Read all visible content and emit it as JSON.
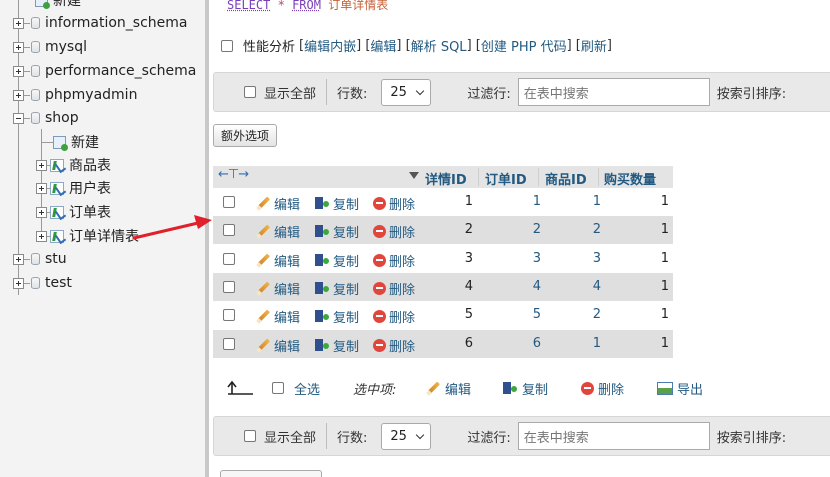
{
  "nav": {
    "items": [
      {
        "label": "新建"
      },
      {
        "label": "information_schema"
      },
      {
        "label": "mysql"
      },
      {
        "label": "performance_schema"
      },
      {
        "label": "phpmyadmin"
      },
      {
        "label": "shop"
      },
      {
        "label": "新建"
      },
      {
        "label": "商品表"
      },
      {
        "label": "用户表"
      },
      {
        "label": "订单表"
      },
      {
        "label": "订单详情表"
      },
      {
        "label": "stu"
      },
      {
        "label": "test"
      }
    ]
  },
  "query": {
    "keyword1": "SELECT",
    "operator": "*",
    "keyword2": "FROM",
    "table": "订单详情表"
  },
  "profiling": {
    "label": "性能分析",
    "links": [
      "编辑内嵌",
      "编辑",
      "解析 SQL",
      "创建 PHP 代码",
      "刷新"
    ]
  },
  "navbar": {
    "show_all": "显示全部",
    "rows_label": "行数:",
    "rows_value": "25",
    "filter_label": "过滤行:",
    "filter_placeholder": "在表中搜索",
    "sort_label": "按索引排序:"
  },
  "extra_options": "额外选项",
  "table": {
    "headers": [
      "详情ID",
      "订单ID",
      "商品ID",
      "购买数量"
    ],
    "actions": {
      "edit": "编辑",
      "copy": "复制",
      "delete": "删除"
    },
    "rows": [
      [
        "1",
        "1",
        "1",
        "1"
      ],
      [
        "2",
        "2",
        "2",
        "1"
      ],
      [
        "3",
        "3",
        "3",
        "1"
      ],
      [
        "4",
        "4",
        "4",
        "1"
      ],
      [
        "5",
        "5",
        "2",
        "1"
      ],
      [
        "6",
        "6",
        "1",
        "1"
      ]
    ]
  },
  "bulk": {
    "select_all": "全选",
    "with_selected": "选中项:",
    "edit": "编辑",
    "copy": "复制",
    "delete": "删除",
    "export": "导出"
  },
  "colors": {
    "link": "#235a81",
    "annotation_arrow": "#e0202a",
    "row_alt": "#dfdfdf"
  }
}
